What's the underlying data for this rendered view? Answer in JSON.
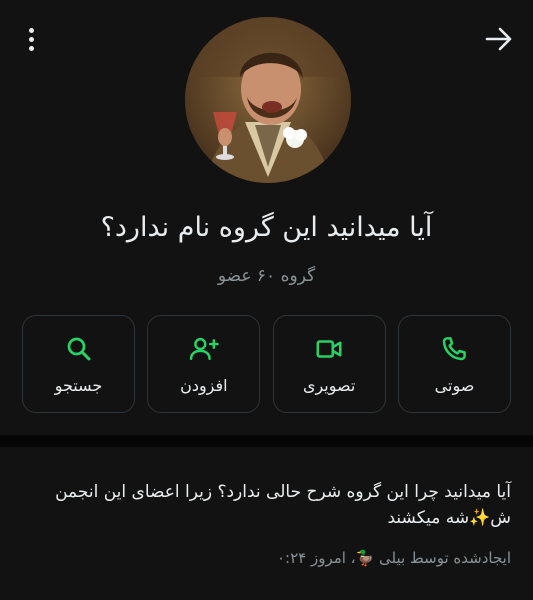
{
  "header": {
    "menu_icon": "more-vertical-icon",
    "back_icon": "arrow-right-icon"
  },
  "group": {
    "title": "آیا میدانید این گروه نام ندارد؟",
    "subtitle": "گروه ۶۰ عضو"
  },
  "actions": [
    {
      "label": "صوتی",
      "icon": "phone-icon"
    },
    {
      "label": "تصویری",
      "icon": "video-icon"
    },
    {
      "label": "افزودن",
      "icon": "add-person-icon"
    },
    {
      "label": "جستجو",
      "icon": "search-icon"
    }
  ],
  "description": {
    "text": "آیا میدانید چرا این گروه شرح حالی ندارد؟ زیرا اعضای این انجمن ش✨شه میکشند",
    "created_by": "ایجادشده توسط بیلی 🦆، امروز ۰:۲۴"
  },
  "colors": {
    "accent": "#25d366",
    "background": "#121212",
    "text_primary": "#e9edef",
    "text_secondary": "#8a9296"
  }
}
